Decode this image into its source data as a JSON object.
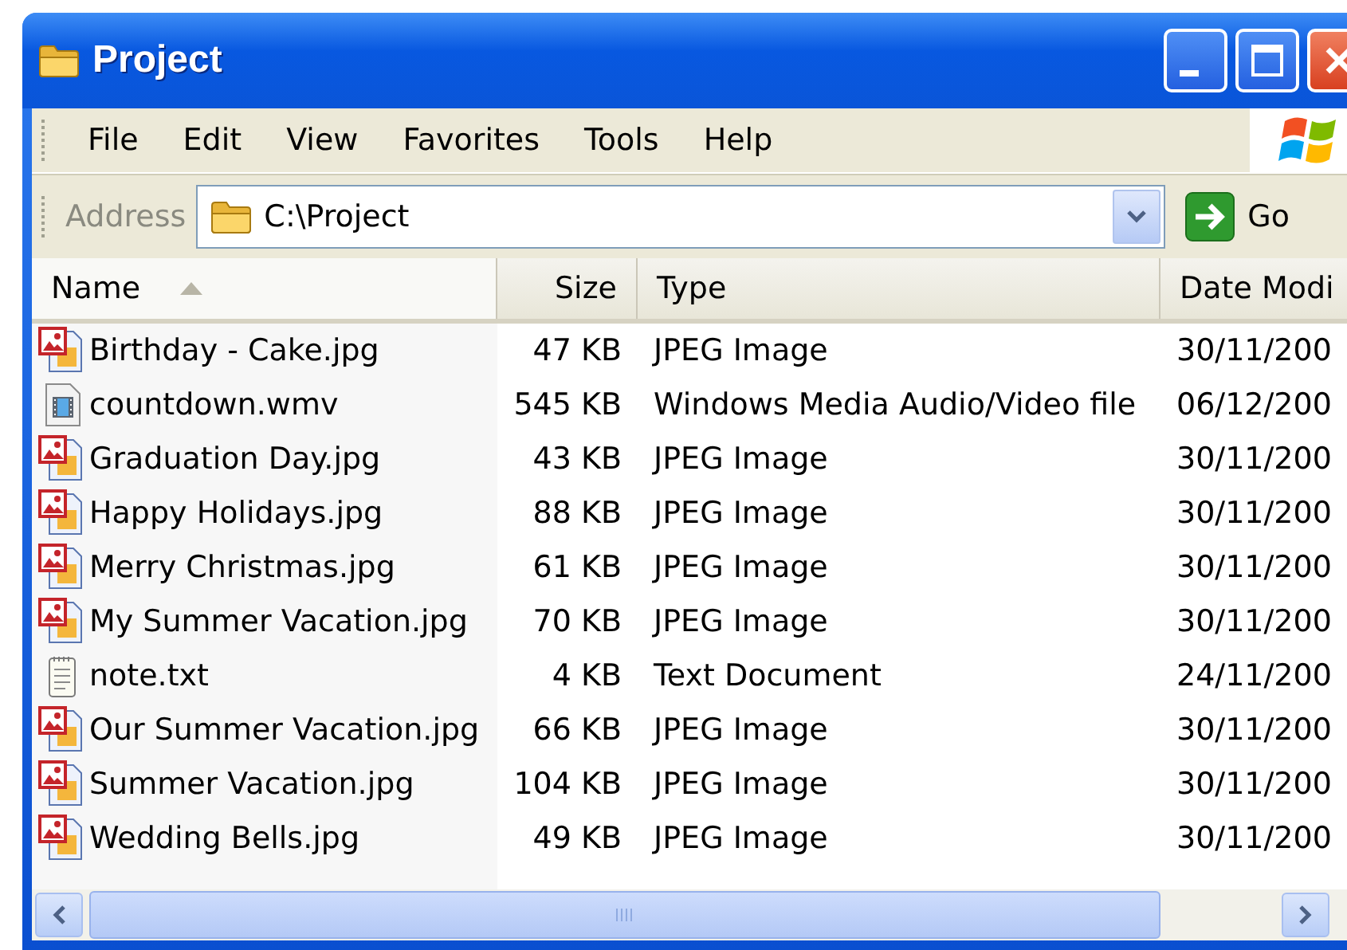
{
  "window": {
    "title": "Project"
  },
  "menu": [
    "File",
    "Edit",
    "View",
    "Favorites",
    "Tools",
    "Help"
  ],
  "address": {
    "label": "Address",
    "value": "C:\\Project",
    "go": "Go"
  },
  "columns": [
    {
      "label": "Name",
      "sorted": true
    },
    {
      "label": "Size",
      "sorted": false
    },
    {
      "label": "Type",
      "sorted": false
    },
    {
      "label": "Date Modi",
      "sorted": false
    }
  ],
  "files": [
    {
      "kind": "image",
      "name": "Birthday - Cake.jpg",
      "size": "47 KB",
      "type": "JPEG Image",
      "date": "30/11/200"
    },
    {
      "kind": "video",
      "name": "countdown.wmv",
      "size": "545 KB",
      "type": "Windows Media Audio/Video file",
      "date": "06/12/200"
    },
    {
      "kind": "image",
      "name": "Graduation Day.jpg",
      "size": "43 KB",
      "type": "JPEG Image",
      "date": "30/11/200"
    },
    {
      "kind": "image",
      "name": "Happy Holidays.jpg",
      "size": "88 KB",
      "type": "JPEG Image",
      "date": "30/11/200"
    },
    {
      "kind": "image",
      "name": "Merry Christmas.jpg",
      "size": "61 KB",
      "type": "JPEG Image",
      "date": "30/11/200"
    },
    {
      "kind": "image",
      "name": "My Summer Vacation.jpg",
      "size": "70 KB",
      "type": "JPEG Image",
      "date": "30/11/200"
    },
    {
      "kind": "text",
      "name": "note.txt",
      "size": "4 KB",
      "type": "Text Document",
      "date": "24/11/200"
    },
    {
      "kind": "image",
      "name": "Our Summer Vacation.jpg",
      "size": "66 KB",
      "type": "JPEG Image",
      "date": "30/11/200"
    },
    {
      "kind": "image",
      "name": "Summer Vacation.jpg",
      "size": "104 KB",
      "type": "JPEG Image",
      "date": "30/11/200"
    },
    {
      "kind": "image",
      "name": "Wedding Bells.jpg",
      "size": "49 KB",
      "type": "JPEG Image",
      "date": "30/11/200"
    }
  ]
}
